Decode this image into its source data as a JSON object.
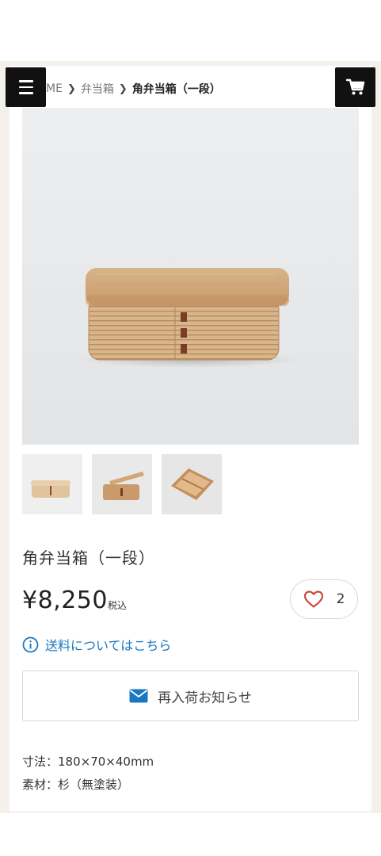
{
  "breadcrumb": {
    "home": "ME",
    "category": "弁当箱",
    "current": "角弁当箱（一段）"
  },
  "product": {
    "name": "角弁当箱（一段）",
    "price": "¥8,250",
    "tax_label": "税込",
    "like_count": "2"
  },
  "shipping_link": "送料についてはこちら",
  "restock_button": "再入荷お知らせ",
  "specs": {
    "size": "寸法：180×70×40mm",
    "material": "素材：杉（無塗装）"
  },
  "icons": {
    "menu": "hamburger-menu-icon",
    "cart": "cart-icon",
    "heart": "heart-icon",
    "info": "info-icon",
    "mail": "mail-icon"
  },
  "colors": {
    "link": "#1a78c2",
    "heart": "#c94a3e",
    "header_button": "#111111"
  }
}
